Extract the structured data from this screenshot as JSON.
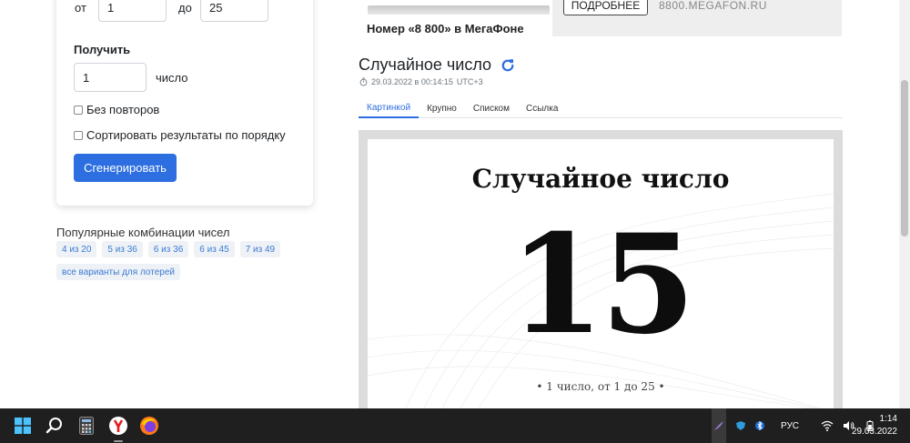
{
  "form": {
    "from_label": "от",
    "from_value": "1",
    "to_label": "до",
    "to_value": "25",
    "get_title": "Получить",
    "count_value": "1",
    "count_unit": "число",
    "no_repeat_label": "Без повторов",
    "sort_label": "Сортировать результаты по порядку",
    "generate_label": "Сгенерировать"
  },
  "popular": {
    "title": "Популярные комбинации чисел",
    "chips": [
      "4 из 20",
      "5 из 36",
      "6 из 36",
      "6 из 45",
      "7 из 49"
    ],
    "all_label": "все варианты для лотерей"
  },
  "ad": {
    "text": "Номер «8 800» в МегаФоне",
    "button": "ПОДРОБНЕЕ",
    "url": "8800.MEGAFON.RU"
  },
  "result": {
    "title": "Случайное число",
    "datetime": "29.03.2022 в 00:14:15",
    "timezone": "UTC+3",
    "tabs": [
      "Картинкой",
      "Крупно",
      "Списком",
      "Ссылка"
    ],
    "active_tab": "Картинкой",
    "picture_title": "Случайное число",
    "number": "15",
    "caption": "• 1 число, от 1 до 25 •"
  },
  "taskbar": {
    "language": "РУС",
    "time": "1:14",
    "date": "29.03.2022",
    "apps": [
      "start-icon",
      "search-icon",
      "calculator-icon",
      "yandex-browser-icon",
      "firefox-icon"
    ]
  },
  "colors": {
    "accent": "#2d6fe0",
    "taskbar": "#1f1f1f"
  }
}
